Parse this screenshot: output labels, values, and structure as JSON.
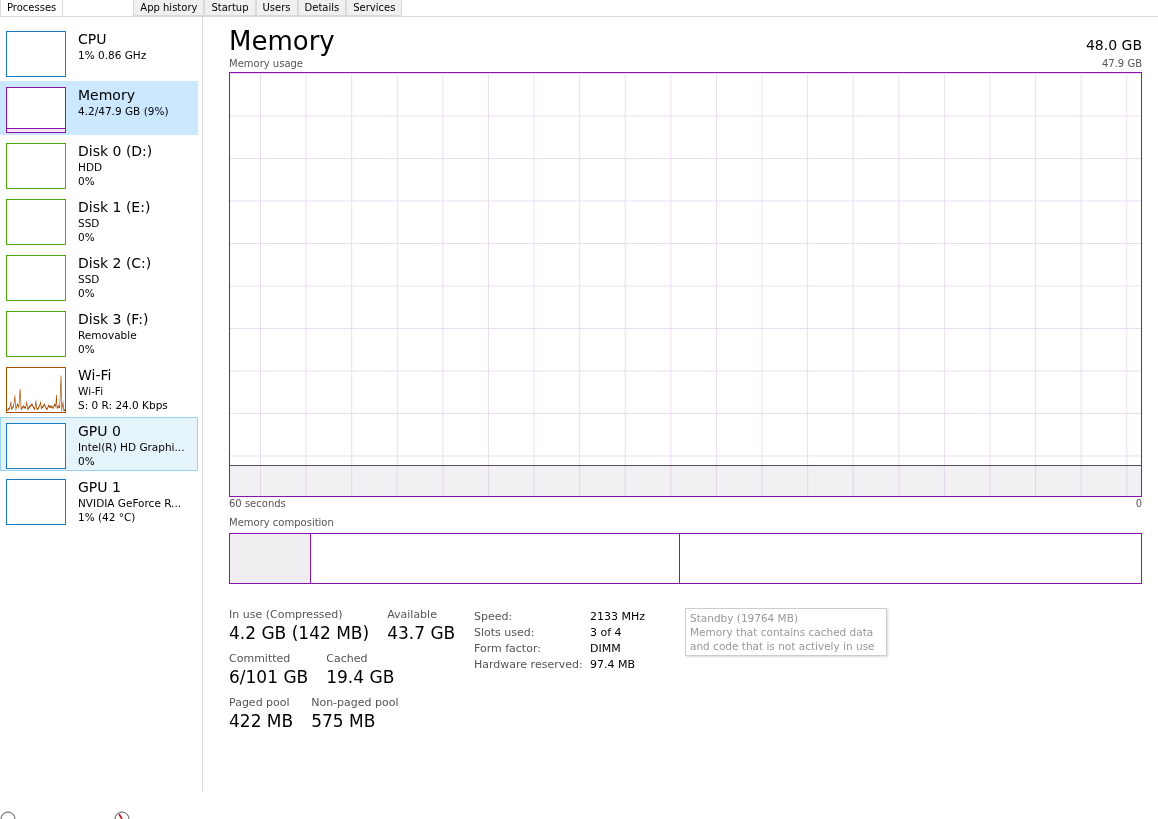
{
  "tabs": [
    {
      "label": "Processes",
      "selected": true
    },
    {
      "label": "App history",
      "selected": false
    },
    {
      "label": "Startup",
      "selected": false
    },
    {
      "label": "Users",
      "selected": false
    },
    {
      "label": "Details",
      "selected": false
    },
    {
      "label": "Services",
      "selected": false
    }
  ],
  "sidebar": {
    "items": [
      {
        "kind": "graph",
        "name": "CPU",
        "lines": [
          "1% 0.86 GHz"
        ],
        "color": "#1c7bc0",
        "selected": false,
        "hovered": false
      },
      {
        "kind": "area",
        "name": "Memory",
        "lines": [
          "4.2/47.9 GB (9%)"
        ],
        "color": "#8b12ae",
        "selected": true,
        "hovered": false
      },
      {
        "kind": "graph",
        "name": "Disk 0 (D:)",
        "lines": [
          "HDD",
          "0%"
        ],
        "color": "#4da60c",
        "selected": false,
        "hovered": false
      },
      {
        "kind": "graph",
        "name": "Disk 1 (E:)",
        "lines": [
          "SSD",
          "0%"
        ],
        "color": "#4da60c",
        "selected": false,
        "hovered": false
      },
      {
        "kind": "graph",
        "name": "Disk 2 (C:)",
        "lines": [
          "SSD",
          "0%"
        ],
        "color": "#4da60c",
        "selected": false,
        "hovered": false
      },
      {
        "kind": "graph",
        "name": "Disk 3 (F:)",
        "lines": [
          "Removable",
          "0%"
        ],
        "color": "#4da60c",
        "selected": false,
        "hovered": false
      },
      {
        "kind": "sparkline",
        "name": "Wi-Fi",
        "lines": [
          "Wi-Fi",
          "S: 0 R: 24.0 Kbps"
        ],
        "color": "#a74f01",
        "selected": false,
        "hovered": false
      },
      {
        "kind": "graph",
        "name": "GPU 0",
        "lines": [
          "Intel(R) HD Graphi...",
          "0%"
        ],
        "color": "#1c7bc0",
        "selected": false,
        "hovered": true
      },
      {
        "kind": "graph",
        "name": "GPU 1",
        "lines": [
          "NVIDIA GeForce R...",
          "1% (42 °C)"
        ],
        "color": "#1c7bc0",
        "selected": false,
        "hovered": false
      }
    ]
  },
  "main": {
    "title": "Memory",
    "total": "48.0 GB",
    "usage_graph": {
      "label": "Memory usage",
      "max_label": "47.9 GB",
      "time_label": "60 seconds",
      "min_label": "0"
    },
    "composition": {
      "label": "Memory composition"
    },
    "tooltip": {
      "title": "Standby (19764 MB)",
      "text": "Memory that contains cached data and code that is not actively in use"
    },
    "stats": [
      [
        {
          "label": "In use (Compressed)",
          "value": "4.2 GB (142 MB)"
        },
        {
          "label": "Available",
          "value": "43.7 GB"
        }
      ],
      [
        {
          "label": "Committed",
          "value": "6/101 GB"
        },
        {
          "label": "Cached",
          "value": "19.4 GB"
        }
      ],
      [
        {
          "label": "Paged pool",
          "value": "422 MB"
        },
        {
          "label": "Non-paged pool",
          "value": "575 MB"
        }
      ]
    ],
    "details": [
      {
        "label": "Speed:",
        "value": "2133 MHz"
      },
      {
        "label": "Slots used:",
        "value": "3 of 4"
      },
      {
        "label": "Form factor:",
        "value": "DIMM"
      },
      {
        "label": "Hardware reserved:",
        "value": "97.4 MB"
      }
    ]
  }
}
